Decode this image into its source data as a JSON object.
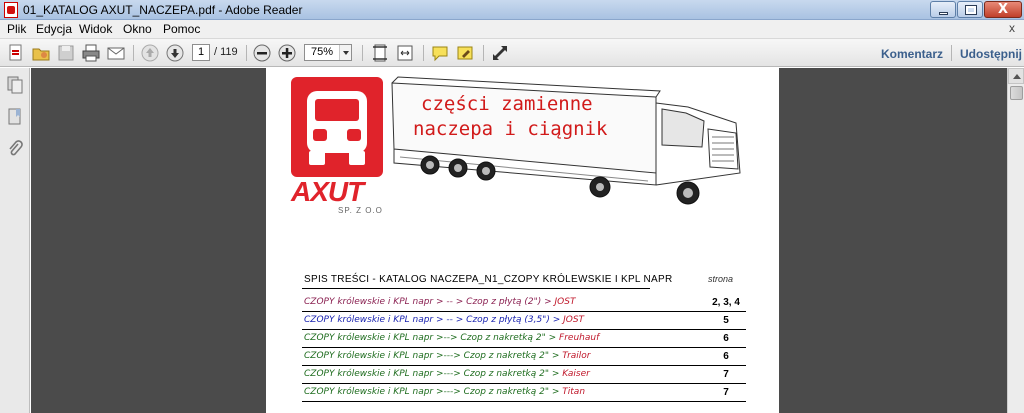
{
  "window": {
    "title": "01_KATALOG AXUT_NACZEPA.pdf - Adobe Reader",
    "close_glyph": "X"
  },
  "menubar": {
    "items": [
      "Plik",
      "Edycja",
      "Widok",
      "Okno",
      "Pomoc"
    ],
    "doc_close": "x"
  },
  "toolbar": {
    "page_current": "1",
    "page_total": "/ 119",
    "zoom": "75%",
    "comment_link": "Komentarz",
    "share_link": "Udostępnij",
    "icons": [
      "create-pdf-icon",
      "open-icon",
      "save-icon",
      "print-icon",
      "email-icon",
      "prev-page-icon",
      "next-page-icon",
      "zoom-out-icon",
      "zoom-in-icon",
      "fit-page-icon",
      "fit-width-icon",
      "comment-icon",
      "highlight-icon",
      "fullscreen-icon"
    ]
  },
  "navpane": {
    "icons": [
      "pages-icon",
      "bookmarks-icon",
      "attachments-icon"
    ]
  },
  "document": {
    "logo_name": "AXUT",
    "logo_sub": "SP. Z O.O",
    "truck_text_line1": "części zamienne",
    "truck_text_line2": "naczepa i ciągnik",
    "toc": {
      "heading": "SPIS TREŚCI - KATALOG NACZEPA_N1_CZOPY KRÓLEWSKIE I KPL NAPR",
      "page_col": "strona",
      "rows": [
        {
          "prefix": "CZOPY królewskie i KPL napr > -- > Czop z płytą (2\") > ",
          "brand": "JOST",
          "page": "2, 3, 4",
          "color": "#8b2252",
          "brand_color": "#c0182b"
        },
        {
          "prefix": "CZOPY królewskie i KPL napr > -- > Czop z płytą (3,5\") > ",
          "brand": "JOST",
          "page": "5",
          "color": "#1a23b0",
          "brand_color": "#c0182b"
        },
        {
          "prefix": "CZOPY królewskie i KPL napr >--> Czop z nakretką 2\" > ",
          "brand": "Freuhauf",
          "page": "6",
          "color": "#1f6d1f",
          "brand_color": "#c0182b"
        },
        {
          "prefix": "CZOPY królewskie i KPL napr >---> Czop z nakretką 2\" > ",
          "brand": "Trailor",
          "page": "6",
          "color": "#1f6d1f",
          "brand_color": "#c0182b"
        },
        {
          "prefix": "CZOPY królewskie i KPL napr >---> Czop z nakretką 2\" > ",
          "brand": "Kaiser",
          "page": "7",
          "color": "#1f6d1f",
          "brand_color": "#c0182b"
        },
        {
          "prefix": "CZOPY królewskie i KPL napr >---> Czop z nakretką 2\" > ",
          "brand": "Titan",
          "page": "7",
          "color": "#1f6d1f",
          "brand_color": "#c0182b"
        }
      ]
    }
  }
}
